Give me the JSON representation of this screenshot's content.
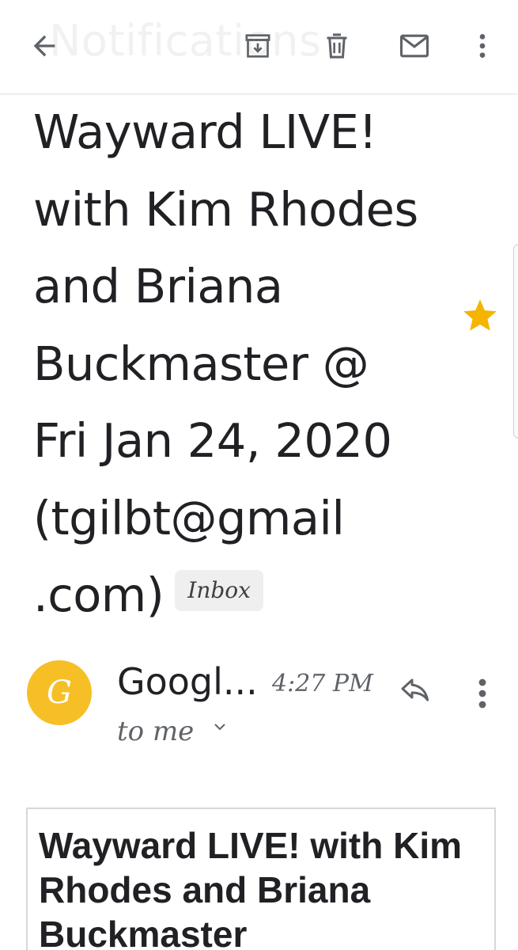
{
  "toolbar": {
    "faded_title": "Notifications",
    "icons": {
      "back": "arrow-back-icon",
      "archive": "archive-icon",
      "delete": "trash-icon",
      "mail": "mail-icon",
      "more": "more-vert-icon"
    }
  },
  "email": {
    "subject": "Wayward LIVE! with Kim Rhodes and Briana Buckmaster @ Fri Jan 24, 2020 (tgilbt@gmail.com)",
    "subject_lines": [
      "Wayward LIVE!",
      "with Kim Rhodes",
      "and Briana",
      "Buckmaster @",
      "Fri Jan 24, 2020",
      "(tgilbt@gmail",
      ".com)"
    ],
    "label_chip": "Inbox",
    "starred": true,
    "star_color": "#f4b400"
  },
  "sender": {
    "avatar_letter": "G",
    "avatar_color": "#f6bf26",
    "name": "Googl...",
    "time": "4:27 PM",
    "recipient": "to me"
  },
  "body": {
    "card_title": "Wayward LIVE! with Kim Rhodes and Briana Buckmaster"
  }
}
